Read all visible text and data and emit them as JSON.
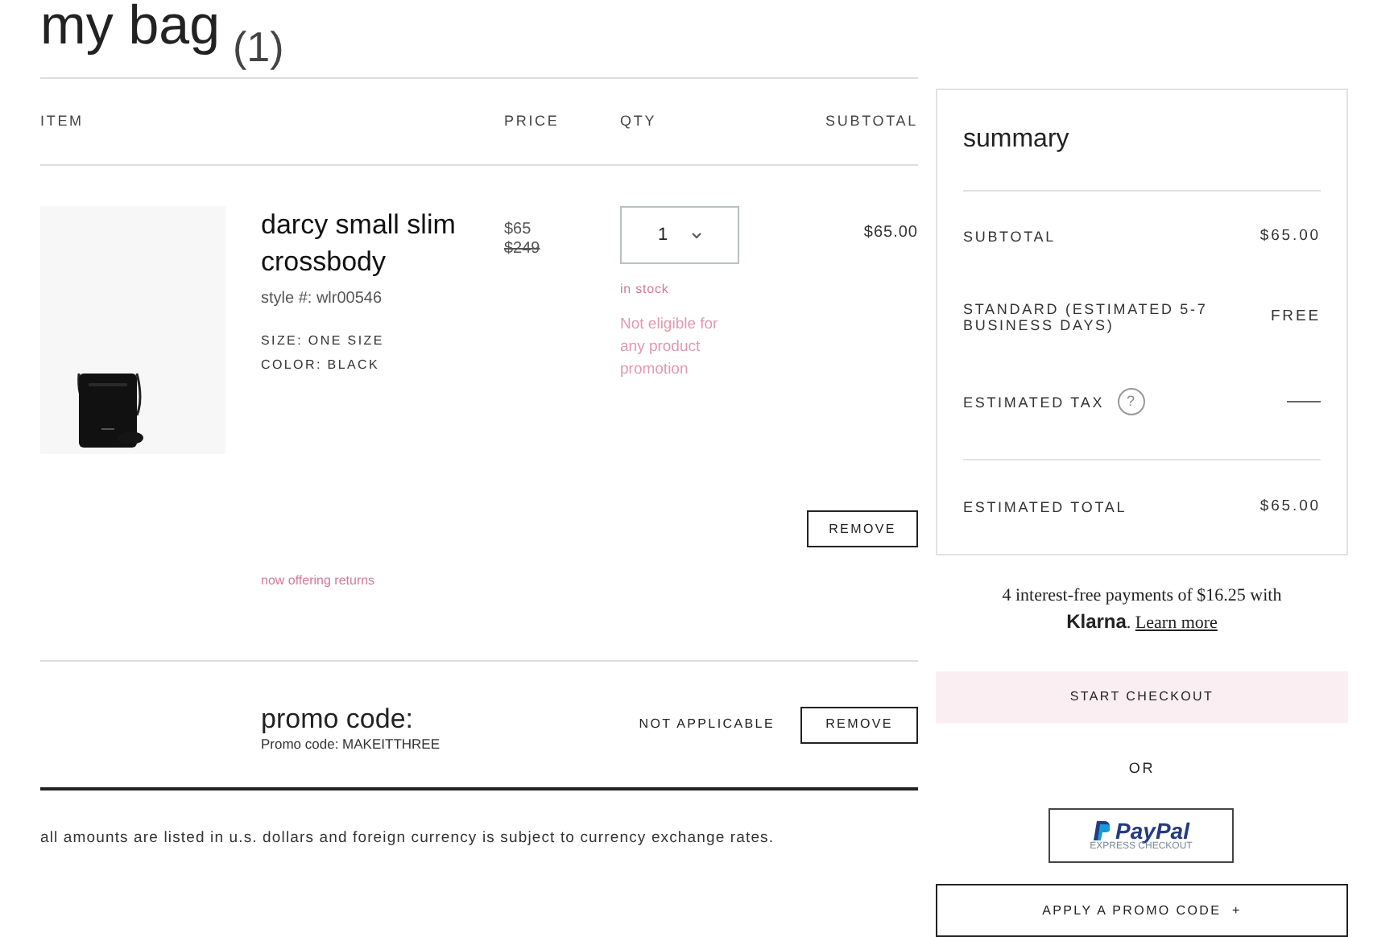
{
  "title": "my bag",
  "count": "(1)",
  "columns": [
    "ITEM",
    "PRICE",
    "QTY",
    "SUBTOTAL"
  ],
  "item": {
    "kind": "picture",
    "name": "darcy small slim crossbody",
    "style": "style #: wlr00546",
    "attributes": [
      "SIZE: ONE SIZE",
      "COLOR: BLACK"
    ],
    "price": "$65",
    "original_price": "$249",
    "qty": "1",
    "stock": "in stock",
    "promo_note": "Not eligible for any product promotion",
    "subtotal": "$65.00",
    "remove": "REMOVE",
    "returns": "now offering returns"
  },
  "promo": {
    "title": "promo code:",
    "code": "Promo code: MAKEITTHREE",
    "status": "NOT APPLICABLE",
    "remove": "REMOVE"
  },
  "disclaimer": "all amounts are listed in u.s. dollars and foreign currency is subject to currency exchange rates.",
  "summary": {
    "title": "summary",
    "rows": [
      {
        "kind": "value",
        "label": "SUBTOTAL",
        "value": "$65.00"
      },
      {
        "kind": "value",
        "label": "STANDARD (ESTIMATED 5-7 BUSINESS DAYS)",
        "value": "FREE"
      },
      {
        "kind": "help",
        "label": "ESTIMATED TAX",
        "help": "?"
      },
      {
        "kind": "total",
        "label": "ESTIMATED TOTAL",
        "value": "$65.00"
      }
    ]
  },
  "klarna": {
    "text": "4 interest-free payments of $16.25 with",
    "brand": "Klarna",
    "separator": ".",
    "link": "Learn more"
  },
  "checkout": "START CHECKOUT",
  "or": "OR",
  "paypal": {
    "logo": "PayPal",
    "caption": "EXPRESS CHECKOUT"
  },
  "apply_promo": "APPLY A PROMO CODE  +"
}
